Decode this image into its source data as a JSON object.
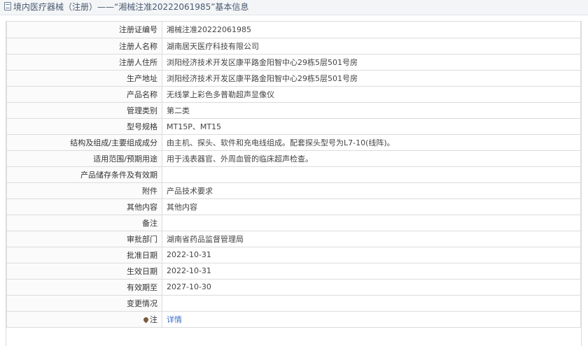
{
  "header": {
    "title": "境内医疗器械（注册）——“湘械注准20222061985”基本信息",
    "icon": "document-icon"
  },
  "rows": [
    {
      "label": "注册证编号",
      "value": "湘械注准20222061985"
    },
    {
      "label": "注册人名称",
      "value": "湖南居天医疗科技有限公司"
    },
    {
      "label": "注册人住所",
      "value": "浏阳经济技术开发区康平路金阳智中心29栋5层501号房"
    },
    {
      "label": "生产地址",
      "value": "浏阳经济技术开发区康平路金阳智中心29栋5层501号房"
    },
    {
      "label": "产品名称",
      "value": "无线掌上彩色多普勒超声显像仪"
    },
    {
      "label": "管理类别",
      "value": "第二类"
    },
    {
      "label": "型号规格",
      "value": "MT15P、MT15"
    },
    {
      "label": "结构及组成/主要组成成分",
      "value": "由主机、探头、软件和充电线组成。配套探头型号为L7-10(线阵)。"
    },
    {
      "label": "适用范围/预期用途",
      "value": "用于浅表器官、外周血管的临床超声检查。"
    },
    {
      "label": "产品储存条件及有效期",
      "value": ""
    },
    {
      "label": "附件",
      "value": "产品技术要求"
    },
    {
      "label": "其他内容",
      "value": "其他内容"
    },
    {
      "label": "备注",
      "value": ""
    },
    {
      "label": "审批部门",
      "value": "湖南省药品监督管理局"
    },
    {
      "label": "批准日期",
      "value": "2022-10-31"
    },
    {
      "label": "生效日期",
      "value": "2022-10-31"
    },
    {
      "label": "有效期至",
      "value": "2027-10-30"
    },
    {
      "label": "变更情况",
      "value": ""
    }
  ],
  "note_row": {
    "label": "注",
    "link_text": "详情",
    "icon": "location-pin-icon"
  }
}
